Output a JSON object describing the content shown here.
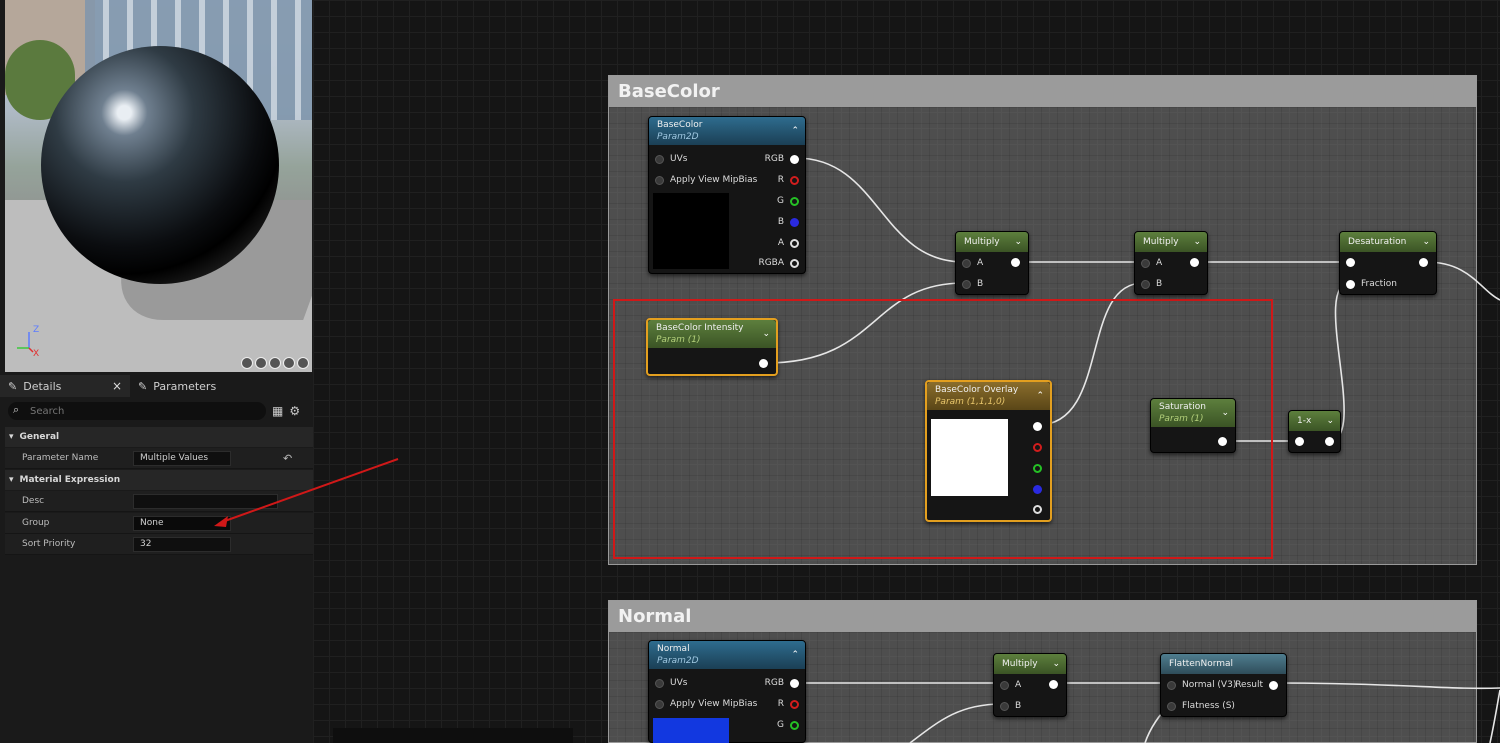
{
  "details": {
    "tabs": [
      {
        "label": "Details",
        "icon": "pencil-icon"
      },
      {
        "label": "Parameters",
        "icon": "pencil-icon"
      }
    ],
    "search_placeholder": "Search",
    "sections": {
      "general": "General",
      "material_expression": "Material Expression"
    },
    "rows": {
      "parameter_name": {
        "label": "Parameter Name",
        "value": "Multiple Values"
      },
      "desc": {
        "label": "Desc",
        "value": ""
      },
      "group": {
        "label": "Group",
        "value": "None"
      },
      "sort_priority": {
        "label": "Sort Priority",
        "value": "32"
      }
    },
    "axis_labels": {
      "z": "Z",
      "x": "X"
    }
  },
  "comments": [
    {
      "title": "BaseColor"
    },
    {
      "title": "Normal"
    }
  ],
  "nodes": {
    "basecolor": {
      "title": "BaseColor",
      "subtitle": "Param2D",
      "inputs": [
        "UVs",
        "Apply View MipBias"
      ],
      "outputs": [
        "RGB",
        "R",
        "G",
        "B",
        "A",
        "RGBA"
      ],
      "preview_color": "#000000"
    },
    "basecolor_intensity": {
      "title": "BaseColor Intensity",
      "subtitle": "Param (1)"
    },
    "multiply1": {
      "title": "Multiply",
      "inputs": [
        "A",
        "B"
      ]
    },
    "multiply2": {
      "title": "Multiply",
      "inputs": [
        "A",
        "B"
      ]
    },
    "desaturation": {
      "title": "Desaturation",
      "inputs": [
        "Fraction"
      ]
    },
    "basecolor_overlay": {
      "title": "BaseColor Overlay",
      "subtitle": "Param (1,1,1,0)",
      "preview_color": "#ffffff"
    },
    "saturation": {
      "title": "Saturation",
      "subtitle": "Param (1)"
    },
    "one_minus": {
      "title": "1-x"
    },
    "normal": {
      "title": "Normal",
      "subtitle": "Param2D",
      "inputs": [
        "UVs",
        "Apply View MipBias"
      ],
      "outputs": [
        "RGB",
        "R",
        "G"
      ],
      "preview_color": "#1238e0"
    },
    "multiply3": {
      "title": "Multiply",
      "inputs": [
        "A",
        "B"
      ]
    },
    "flattennormal": {
      "title": "FlattenNormal",
      "inputs": [
        "Normal (V3)",
        "Flatness (S)"
      ],
      "output": "Result"
    }
  },
  "colors": {
    "selection": "#e39f1f",
    "highlight_box": "#d01818",
    "annotation_arrow": "#d01818"
  }
}
